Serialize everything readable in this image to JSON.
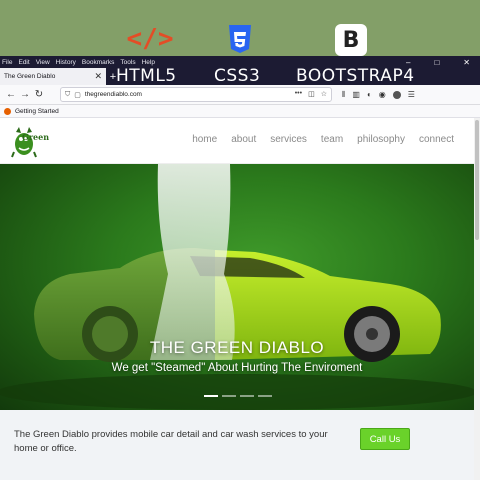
{
  "tech": {
    "html5_label": "HTML5",
    "css3_label": "CSS3",
    "bootstrap_label": "BOOTSTRAP4",
    "bootstrap_letter": "B",
    "html_symbol": "</>"
  },
  "browser": {
    "menu": [
      "File",
      "Edit",
      "View",
      "History",
      "Bookmarks",
      "Tools",
      "Help"
    ],
    "window_controls": [
      "–",
      "□",
      "✕"
    ],
    "tab_title": "The Green Diablo",
    "tab_close": "✕",
    "new_tab": "+",
    "url": "thegreendiablo.com",
    "url_actions": "•••",
    "bookmark": "Getting Started"
  },
  "site": {
    "logo_text": "Green",
    "nav": [
      "home",
      "about",
      "services",
      "team",
      "philosophy",
      "connect"
    ],
    "hero_title": "THE GREEN DIABLO",
    "hero_subtitle": "We get \"Steamed\" About Hurting The Enviroment",
    "info_text": "The Green Diablo provides mobile car detail and car wash services to your home or office.",
    "cta": "Call Us"
  },
  "colors": {
    "accent": "#6ad22a",
    "background": "#839f68",
    "hero": "#2b7a1c"
  }
}
